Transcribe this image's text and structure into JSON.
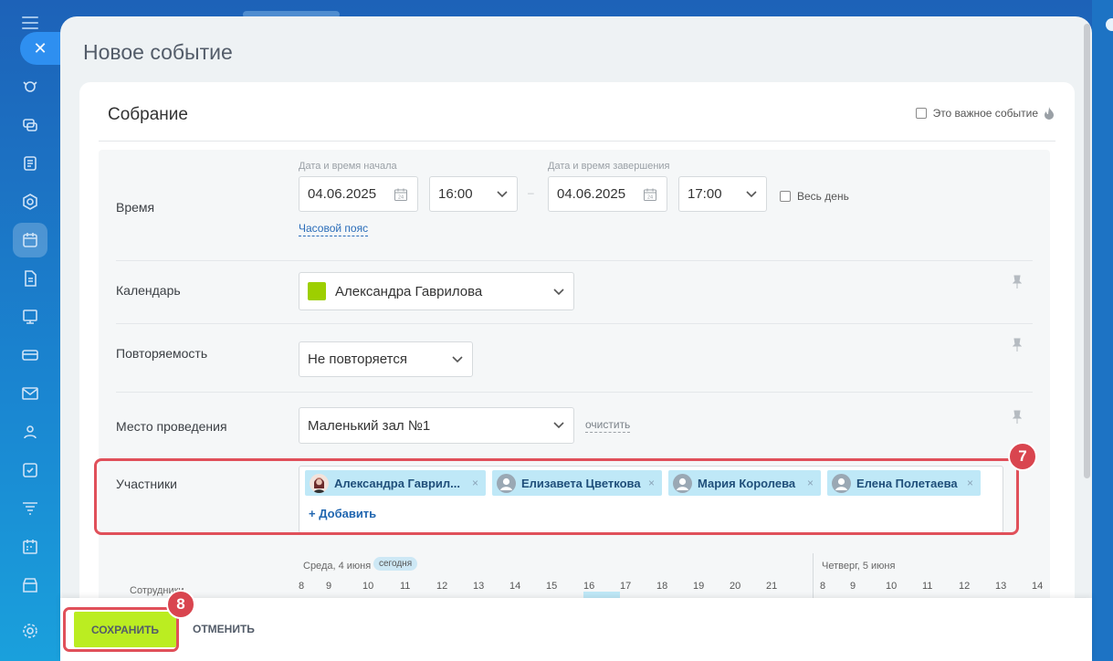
{
  "panel": {
    "title": "Новое событие"
  },
  "event": {
    "name": "Собрание",
    "important_label": "Это важное событие"
  },
  "time": {
    "label": "Время",
    "start_caption": "Дата и время начала",
    "end_caption": "Дата и время завершения",
    "start_date": "04.06.2025",
    "start_time": "16:00",
    "end_date": "04.06.2025",
    "end_time": "17:00",
    "all_day_label": "Весь день",
    "timezone_link": "Часовой пояс",
    "dash": "–"
  },
  "calendar": {
    "label": "Календарь",
    "value": "Александра Гаврилова",
    "color": "#9dcf00"
  },
  "repeat": {
    "label": "Повторяемость",
    "value": "Не повторяется"
  },
  "location": {
    "label": "Место проведения",
    "value": "Маленький зал №1",
    "clear_link": "очистить"
  },
  "participants": {
    "label": "Участники",
    "items": [
      {
        "name": "Александра Гаврил..."
      },
      {
        "name": "Елизавета Цветкова"
      },
      {
        "name": "Мария Королева"
      },
      {
        "name": "Елена Полетаева"
      }
    ],
    "remove_glyph": "×",
    "add_label": "+ Добавить"
  },
  "timeline": {
    "day1": "Среда, 4 июня",
    "today": "сегодня",
    "day2": "Четверг, 5 июня",
    "row_label": "Сотрудники",
    "hours1": [
      "8",
      "9",
      "10",
      "11",
      "12",
      "13",
      "14",
      "15",
      "16",
      "17",
      "18",
      "19",
      "20",
      "21"
    ],
    "hours2": [
      "8",
      "9",
      "10",
      "11",
      "12",
      "13",
      "14"
    ]
  },
  "annotations": {
    "badge7": "7",
    "badge8": "8"
  },
  "footer": {
    "save_label": "СОХРАНИТЬ",
    "cancel_label": "ОТМЕНИТЬ"
  },
  "colors": {
    "accent_save": "#bbed21",
    "highlight": "#e0505a",
    "chip": "#bfe8f7"
  }
}
